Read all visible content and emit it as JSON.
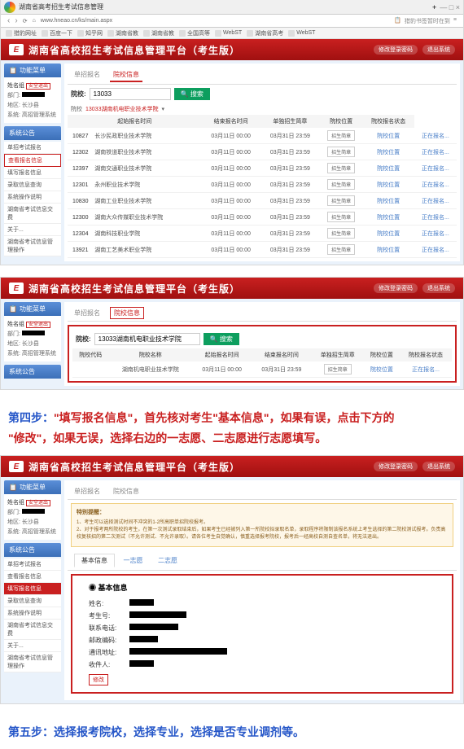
{
  "browser": {
    "tab_title": "湖南省高考招生考试信息管理",
    "url": "www.hneao.cn/ks/main.aspx",
    "print_label": "猎豹书签暂时在到"
  },
  "bookmarks": [
    "猎豹网址",
    "百度一下",
    "知乎网",
    "湖南省教",
    "湖南省教",
    "全国高等",
    "WebST",
    "湖南省高考",
    "WebST"
  ],
  "header": {
    "title": "湖南省高校招生考试信息管理平台（考生版）",
    "change_pwd": "修改登录密码",
    "logout": "退出系统"
  },
  "sidebar": {
    "menu_title": "功能菜单",
    "user_label": "姓名组",
    "safe_exit": "安全退出",
    "dept_label": "部门",
    "addr_label": "地区",
    "addr_val": "长沙县",
    "role_label": "系统",
    "role_val": "高招管理系统",
    "notice_title": "系统公告",
    "items": [
      "单招考试报名",
      "查看报名信息",
      "填写报名信息",
      "录取信息查询",
      "系统操作说明",
      "湖南省考试信息交费",
      "关于...",
      "湖南省考试信息管理操作"
    ]
  },
  "tabs": {
    "single": "单招报名",
    "school": "院校信息"
  },
  "search": {
    "label": "院校:",
    "value": "13033",
    "dropdown_label": "院校",
    "dropdown_value": "13033湖南机电职业技术学院",
    "btn": "搜索",
    "search_icon": "🔍"
  },
  "table_headers": {
    "code": "院校代码",
    "name": "院校名称",
    "start": "起始报名时间",
    "end": "结束报名时间",
    "brochure": "单独招生简章",
    "location": "院校位置",
    "status": "院校报名状态"
  },
  "table_btn": {
    "brochure": "招生简章",
    "location": "院校位置",
    "status": "正在报名..."
  },
  "schools1": [
    {
      "code": "10827",
      "name": "长沙民政职业技术学院",
      "start": "03月11日 00:00",
      "end": "03月31日 23:59"
    },
    {
      "code": "12302",
      "name": "湖南铁道职业技术学院",
      "start": "03月11日 00:00",
      "end": "03月31日 23:59"
    },
    {
      "code": "12397",
      "name": "湖南交通职业技术学院",
      "start": "03月11日 00:00",
      "end": "03月31日 23:59"
    },
    {
      "code": "12301",
      "name": "永州职业技术学院",
      "start": "03月11日 00:00",
      "end": "03月31日 23:59"
    },
    {
      "code": "10830",
      "name": "湖南工业职业技术学院",
      "start": "03月11日 00:00",
      "end": "03月31日 23:59"
    },
    {
      "code": "12300",
      "name": "湖南大众传媒职业技术学院",
      "start": "03月11日 00:00",
      "end": "03月31日 23:59"
    },
    {
      "code": "12304",
      "name": "湖南科技职业学院",
      "start": "03月11日 00:00",
      "end": "03月31日 23:59"
    },
    {
      "code": "13921",
      "name": "湖南工艺美术职业学院",
      "start": "03月11日 00:00",
      "end": "03月31日 23:59"
    }
  ],
  "schools2": [
    {
      "code": "",
      "name": "湖南机电职业技术学院",
      "start": "03月11日 00:00",
      "end": "03月31日 23:59"
    }
  ],
  "instruction4": {
    "prefix": "第四步：",
    "p1a": "\"填写报名信息\"，首先核对考生\"基本信息\"，如果有误，点击下方的",
    "p2a": "\"修改\"，如果无误，选择右边的一志愿、二志愿进行志愿填写。"
  },
  "notice": {
    "title": "特别提醒：",
    "line1": "1、考生可以选择测试时间不冲突的1-2所高职单招院校报考。",
    "line2": "2、对于报考两所院校的考生，在第一次测试录取结束后，如果考生已经被列入第一所院校拟录取名单，录取程序将限制该报名系统上考生选择的第二院校测试报考。负责高校复核招的第二次测试（不允许测试、不允许录取）。请各位考生自觉确认，慎重选择报考院校，报考后一经高校自测自查名单，将无法退出。"
  },
  "form_tabs": {
    "basic": "基本信息",
    "vol1": "一志愿",
    "vol2": "二志愿"
  },
  "basic_info": {
    "title": "基本信息",
    "fields": {
      "name": "姓名:",
      "student_id": "考生号:",
      "phone": "联系电话:",
      "postcode": "邮政编码:",
      "address": "通讯地址:",
      "recipient": "收件人:"
    },
    "modify": "修改"
  },
  "instruction5": {
    "prefix": "第五步：",
    "text": "选择报考院校，选择专业，选择是否专业调剂等。"
  }
}
